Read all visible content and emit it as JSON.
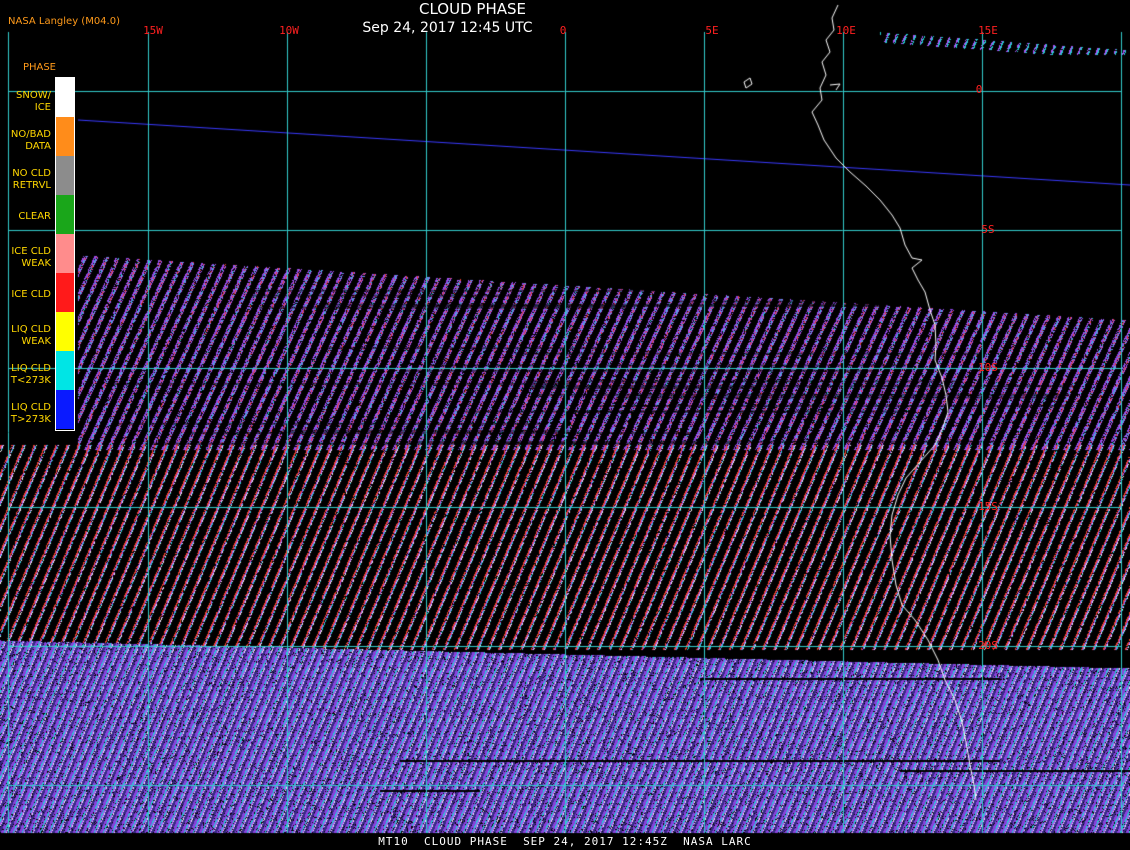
{
  "header": {
    "title": "CLOUD PHASE",
    "subtitle": "Sep 24, 2017 12:45 UTC",
    "credit": "NASA Langley (M04.0)"
  },
  "grid": {
    "longitudes": [
      "15W",
      "10W",
      "0",
      "5E",
      "10E",
      "15E"
    ],
    "latitudes": [
      "0",
      "5S",
      "10S",
      "15S",
      "20S"
    ],
    "line_color": "#33cccc",
    "label_color": "#ff2020"
  },
  "legend": {
    "title": "PHASE",
    "items": [
      {
        "label": "SNOW/\nICE",
        "color": "#ffffff"
      },
      {
        "label": "NO/BAD\nDATA",
        "color": "#ff8c1a"
      },
      {
        "label": "NO CLD\nRETRVL",
        "color": "#8c8c8c"
      },
      {
        "label": "CLEAR",
        "color": "#1aa61a"
      },
      {
        "label": "ICE CLD\nWEAK",
        "color": "#ff8c8c"
      },
      {
        "label": "ICE CLD",
        "color": "#ff1a1a"
      },
      {
        "label": "LIQ CLD\nWEAK",
        "color": "#ffff00"
      },
      {
        "label": "LIQ CLD\nT<273K",
        "color": "#00e5e5"
      },
      {
        "label": "LIQ CLD\nT>273K",
        "color": "#0a1aff"
      }
    ]
  },
  "footer": {
    "text": "MT10  CLOUD PHASE  SEP 24, 2017 12:45Z  NASA LARC"
  },
  "colors": {
    "background": "#000000",
    "coastline": "#ffffff",
    "scan_track": "#3a3aff"
  }
}
